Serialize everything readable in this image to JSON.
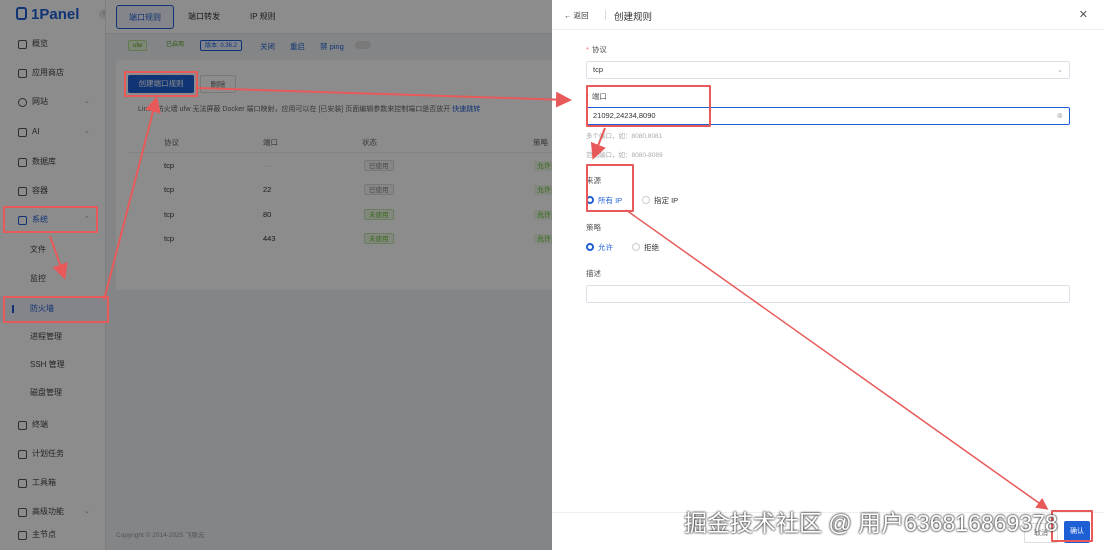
{
  "app": {
    "name": "1Panel"
  },
  "sidebar": {
    "items": [
      {
        "label": "概览"
      },
      {
        "label": "应用商店"
      },
      {
        "label": "网站"
      },
      {
        "label": "AI"
      },
      {
        "label": "数据库"
      },
      {
        "label": "容器"
      },
      {
        "label": "系统"
      },
      {
        "label": "终端"
      },
      {
        "label": "计划任务"
      },
      {
        "label": "工具箱"
      },
      {
        "label": "高级功能"
      },
      {
        "label": "主节点"
      }
    ],
    "sub_items": [
      {
        "label": "文件"
      },
      {
        "label": "监控"
      },
      {
        "label": "防火墙"
      },
      {
        "label": "进程管理"
      },
      {
        "label": "SSH 管理"
      },
      {
        "label": "磁盘管理"
      }
    ]
  },
  "tabs": [
    {
      "label": "端口规则"
    },
    {
      "label": "端口转发"
    },
    {
      "label": "IP 规则"
    }
  ],
  "status": {
    "engine": "ufw",
    "state": "已启用",
    "version": "版本: 0.36.2",
    "stop": "关闭",
    "restart": "重启",
    "ping_label": "禁 ping"
  },
  "main": {
    "create_button": "创建端口规则",
    "delete_button": "删除",
    "notice": "Linux 防火墙 ufw 无法屏蔽 Docker 端口映射，应用可以在 [已安装] 页面编辑参数来控制端口是否放开",
    "notice_link": "快速跳转",
    "columns": [
      "协议",
      "端口",
      "状态",
      "策略"
    ],
    "rows": [
      {
        "protocol": "tcp",
        "port": "····",
        "status": "已使用",
        "policy": "允许"
      },
      {
        "protocol": "tcp",
        "port": "22",
        "status": "已使用",
        "policy": "允许"
      },
      {
        "protocol": "tcp",
        "port": "80",
        "status": "未使用",
        "policy": "允许"
      },
      {
        "protocol": "tcp",
        "port": "443",
        "status": "未使用",
        "policy": "允许"
      }
    ],
    "footer": "Copyright © 2014-2025 飞致云"
  },
  "drawer": {
    "back": "返回",
    "title": "创建规则",
    "protocol_label": "协议",
    "protocol_value": "tcp",
    "port_label": "端口",
    "port_value": "21092,24234,8090",
    "port_hint1": "多个端口，如：8080,8081",
    "port_hint2": "范围端口，如：8080-8089",
    "source_label": "来源",
    "source_all": "所有 IP",
    "source_specific": "指定 IP",
    "strategy_label": "策略",
    "strategy_allow": "允许",
    "strategy_deny": "拒绝",
    "desc_label": "描述",
    "cancel": "取消",
    "confirm": "确认"
  },
  "watermark": "掘金技术社区 @ 用户636816869378"
}
